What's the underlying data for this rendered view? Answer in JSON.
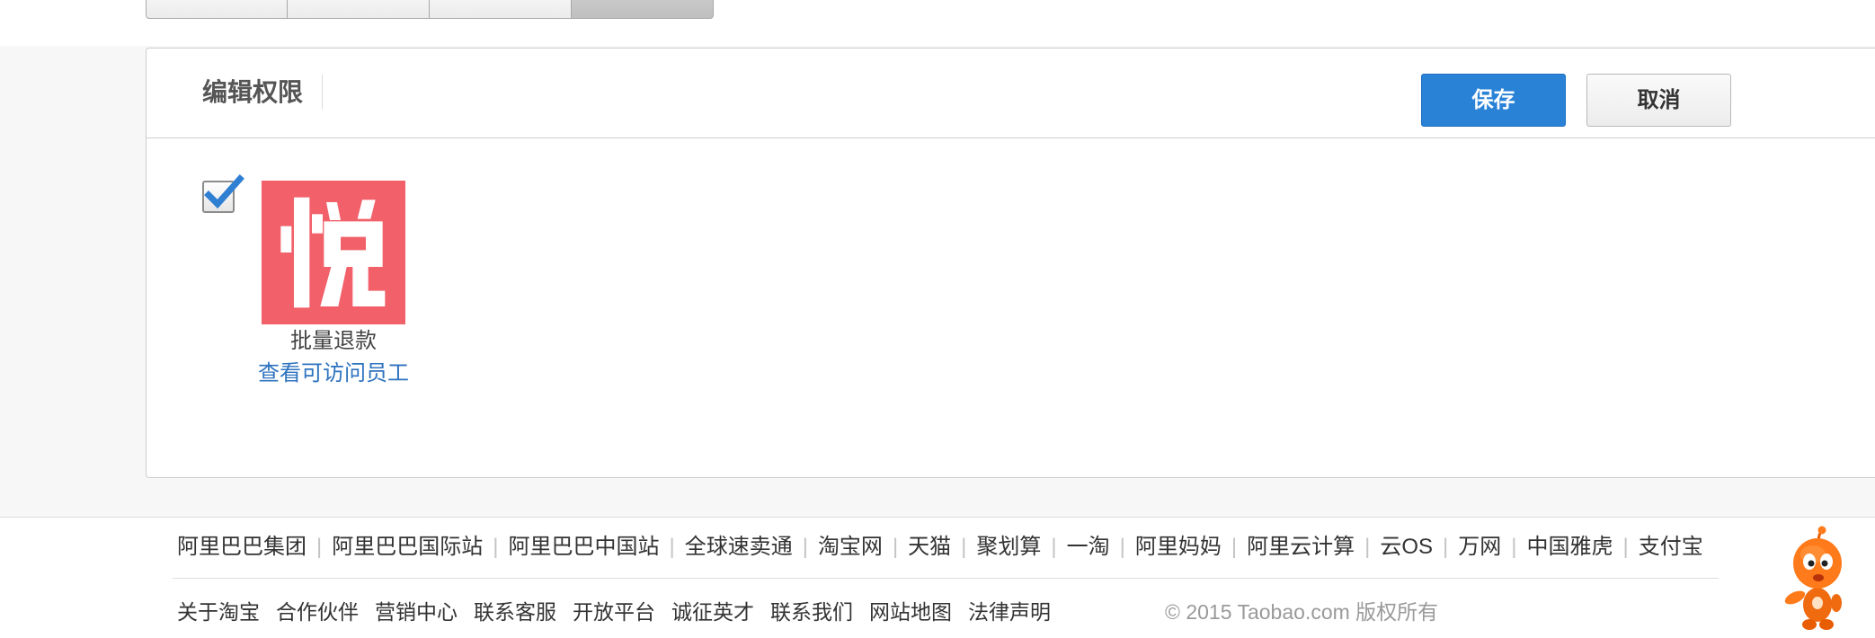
{
  "tabs": {
    "active_index": 3
  },
  "panel": {
    "title": "编辑权限",
    "save_label": "保存",
    "cancel_label": "取消"
  },
  "apps": [
    {
      "checked": true,
      "icon": "yue-app-logo-icon",
      "icon_glyph": "悦",
      "icon_color": "#f2606a",
      "name": "批量退款",
      "link_label": "查看可访问员工"
    }
  ],
  "footer": {
    "separator": "|",
    "group_links": [
      "阿里巴巴集团",
      "阿里巴巴国际站",
      "阿里巴巴中国站",
      "全球速卖通",
      "淘宝网",
      "天猫",
      "聚划算",
      "一淘",
      "阿里妈妈",
      "阿里云计算",
      "云OS",
      "万网",
      "中国雅虎",
      "支付宝"
    ],
    "site_links": [
      "关于淘宝",
      "合作伙伴",
      "营销中心",
      "联系客服",
      "开放平台",
      "诚征英才",
      "联系我们",
      "网站地图",
      "法律声明"
    ],
    "copyright": "© 2015 Taobao.com 版权所有",
    "mascot": "taobao-mascot-icon"
  },
  "colors": {
    "primary_button": "#2a82d7",
    "link": "#2e73bf",
    "page_background": "#f7f7f7",
    "app_icon": "#f2606a",
    "checkmark": "#2f7fd3",
    "mascot": "#ff7a1a"
  }
}
